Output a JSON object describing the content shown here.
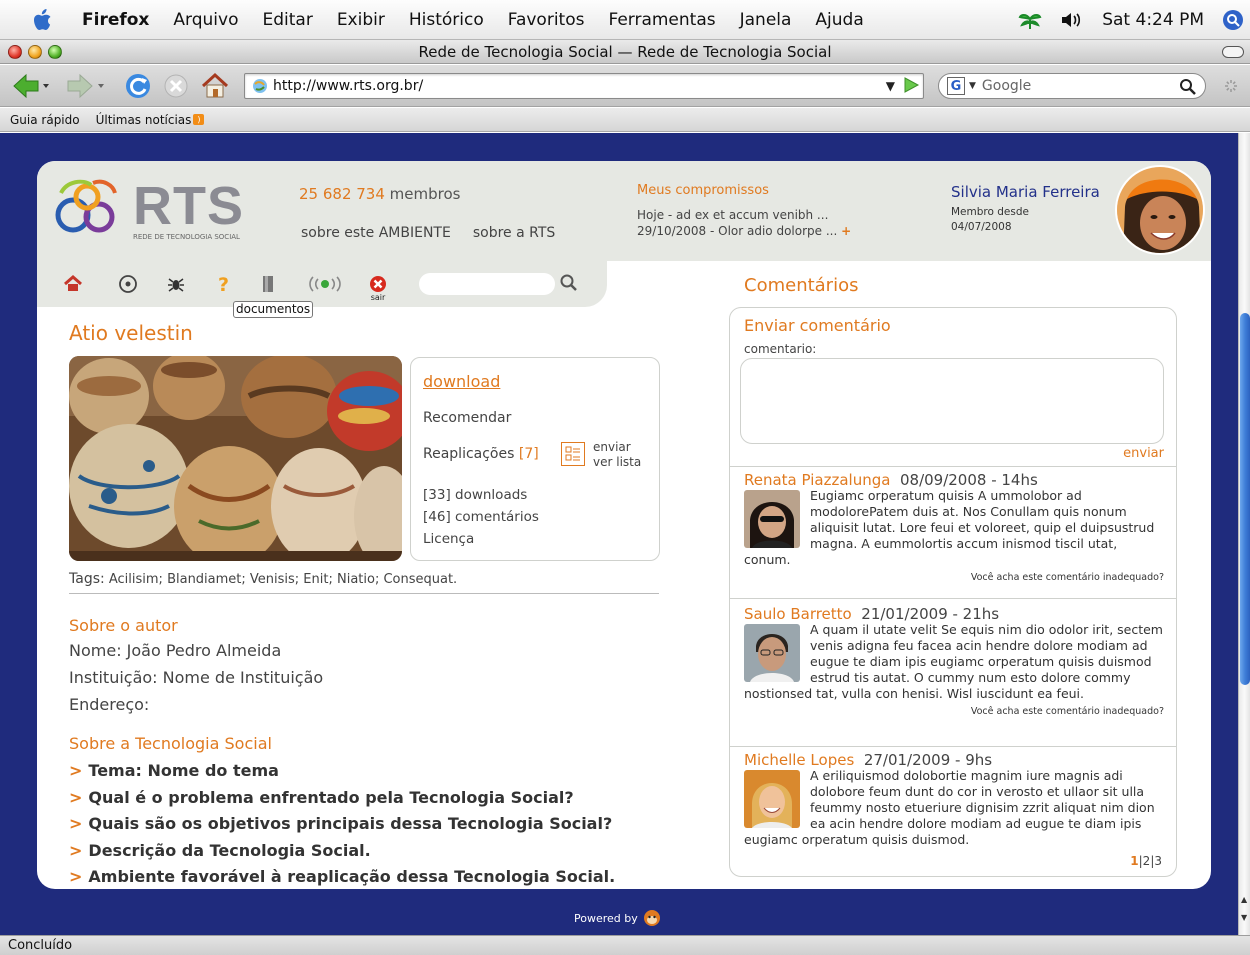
{
  "menubar": {
    "app": "Firefox",
    "items": [
      "Arquivo",
      "Editar",
      "Exibir",
      "Histórico",
      "Favoritos",
      "Ferramentas",
      "Janela",
      "Ajuda"
    ],
    "clock": "Sat 4:24 PM"
  },
  "window": {
    "title": "Rede de Tecnologia Social — Rede de Tecnologia Social"
  },
  "toolbar": {
    "url": "http://www.rts.org.br/",
    "search_placeholder": "Google"
  },
  "bookmarks": [
    "Guia rápido",
    "Últimas notícias"
  ],
  "status": "Concluído",
  "header": {
    "logo_text": "RTS",
    "logo_sub": "REDE DE TECNOLOGIA SOCIAL",
    "members_count": "25 682 734",
    "members_label": "membros",
    "link_ambiente": "sobre este AMBIENTE",
    "link_rts": "sobre a RTS",
    "compromissos_title": "Meus compromissos",
    "compromisso_1": "Hoje - ad ex et accum venibh ...",
    "compromisso_2": "29/10/2008 -  Olor adio dolorpe ...",
    "plus": "+",
    "user_name": "Silvia Maria Ferreira",
    "member_since_label": "Membro desde",
    "member_since_date": "04/07/2008"
  },
  "iconbar": {
    "tooltip": "documentos",
    "exit_label": "sair",
    "icons": [
      "home-icon",
      "target-icon",
      "bug-icon",
      "help-icon",
      "document-icon",
      "signal-icon",
      "exit-icon",
      "search-icon"
    ]
  },
  "content": {
    "title": "Atio velestin",
    "download": "download",
    "recomendar": "Recomendar",
    "reaplicacoes_label": "Reaplicações",
    "reaplicacoes_count": "[7]",
    "enviar": "enviar",
    "ver_lista": "ver lista",
    "downloads": "[33] downloads",
    "comentarios": "[46] comentários",
    "licenca": "Licença",
    "tags_label": "Tags:",
    "tags": "Acilisim; Blandiamet; Venisis; Enit; Niatio; Consequat.",
    "autor_title": "Sobre o autor",
    "nome": "Nome: João Pedro Almeida",
    "instituicao": "Instituição: Nome de Instituição",
    "endereco": "Endereço:",
    "tech_title": "Sobre a Tecnologia Social",
    "tech_items": [
      "Tema: Nome do tema",
      "Qual é o problema enfrentado pela Tecnologia Social?",
      "Quais são os objetivos principais dessa Tecnologia Social?",
      "Descrição da Tecnologia Social.",
      "Ambiente favorável à reaplicação dessa Tecnologia Social."
    ]
  },
  "comments": {
    "title": "Comentários",
    "form_title": "Enviar comentário",
    "form_label": "comentario:",
    "send": "enviar",
    "report": "Você acha este comentário inadequado?",
    "items": [
      {
        "name": "Renata Piazzalunga",
        "date": "08/09/2008 - 14hs",
        "text": "Eugiamc orperatum quisis A ummolobor ad modolorePatem duis at. Nos Conullam quis nonum aliquisit lutat. Lore feui et voloreet, quip el duipsustrud magna. A eummolortis accum inismod tiscil utat, conum."
      },
      {
        "name": "Saulo Barretto",
        "date": "21/01/2009 - 21hs",
        "text": "A quam il utate velit Se equis nim dio odolor irit, sectem venis adigna feu facea acin hendre dolore modiam ad eugue te diam ipis eugiamc orperatum quisis duismod estrud tis autat. O cummy num esto dolore commy nostionsed tat, vulla con henisi. Wisl iuscidunt ea feui."
      },
      {
        "name": "Michelle Lopes",
        "date": "27/01/2009 - 9hs",
        "text": "A eriliquismod dolobortie magnim iure magnis adi dolobore feum dunt do cor in verosto et ullaor sit ulla feummy nosto etueriure dignisim zzrit aliquat nim dion ea acin hendre dolore modiam ad eugue te diam ipis eugiamc orperatum quisis duismod."
      }
    ],
    "pager_current": "1",
    "pager_rest": "|2|3"
  },
  "footer": {
    "powered": "Powered by"
  }
}
